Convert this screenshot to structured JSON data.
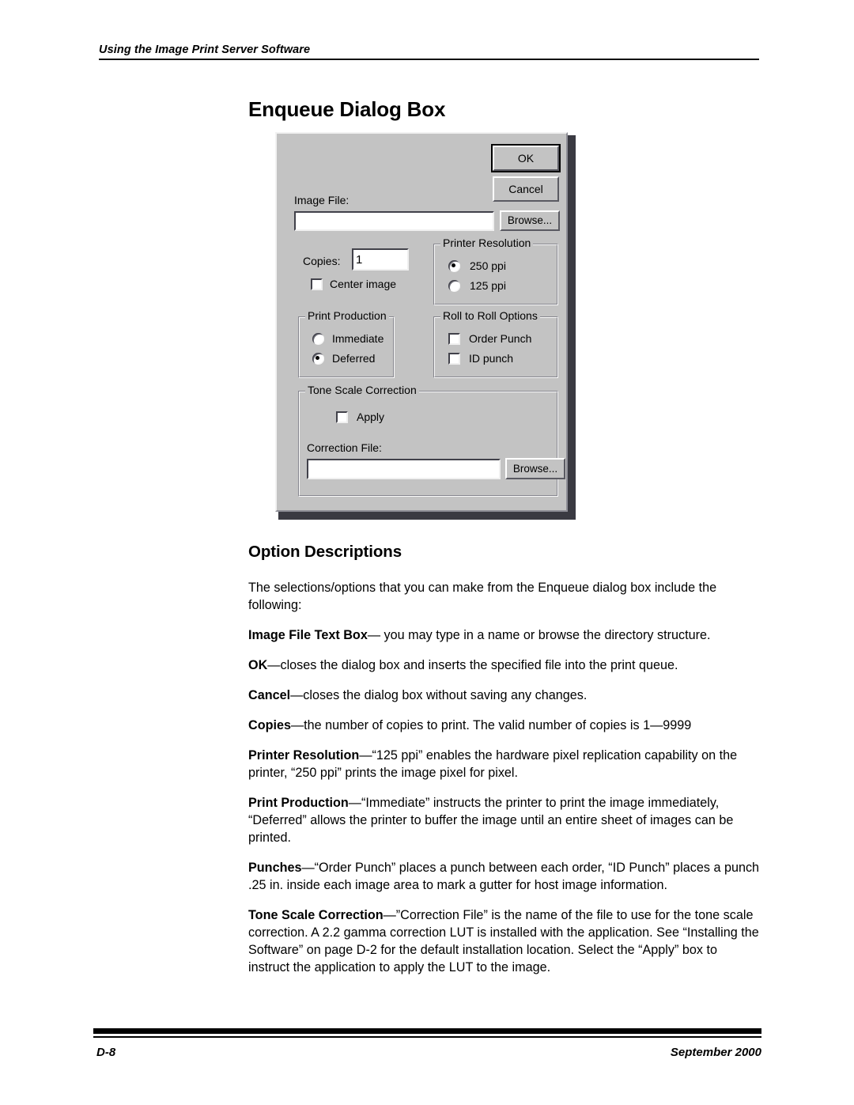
{
  "page": {
    "running_header": "Using the Image Print Server Software",
    "title": "Enqueue Dialog Box",
    "footer_left": "D-8",
    "footer_right": "September 2000"
  },
  "dialog": {
    "buttons": {
      "ok": "OK",
      "cancel": "Cancel",
      "browse_image": "Browse...",
      "browse_correction": "Browse..."
    },
    "image_file": {
      "label": "Image File:",
      "value": "",
      "placeholder": ""
    },
    "copies": {
      "label": "Copies:",
      "value": "1"
    },
    "center_image": {
      "label": "Center image",
      "checked": false
    },
    "printer_resolution": {
      "title": "Printer Resolution",
      "options": [
        {
          "label": "250 ppi",
          "selected": true
        },
        {
          "label": "125 ppi",
          "selected": false
        }
      ]
    },
    "print_production": {
      "title": "Print Production",
      "options": [
        {
          "label": "Immediate",
          "selected": false
        },
        {
          "label": "Deferred",
          "selected": true
        }
      ]
    },
    "roll_to_roll": {
      "title": "Roll to Roll Options",
      "options": [
        {
          "label": "Order Punch",
          "checked": false
        },
        {
          "label": "ID punch",
          "checked": false
        }
      ]
    },
    "tone_scale": {
      "title": "Tone Scale Correction",
      "apply_label": "Apply",
      "apply_checked": false,
      "correction_file_label": "Correction File:",
      "correction_file_value": "",
      "correction_file_placeholder": ""
    },
    "colors": {
      "face": "#c3c3c3",
      "highlight": "#ffffff",
      "shadow": "#5a5a62",
      "field": "#ffffff"
    }
  },
  "content": {
    "sub_heading": "Option Descriptions",
    "intro": "The selections/options that you can make from the Enqueue dialog box include the following:",
    "items": [
      {
        "term": "Image File Text Box",
        "sep": "— ",
        "text": "you may type in a name or browse the directory structure."
      },
      {
        "term": "OK",
        "sep": "—",
        "text": "closes the dialog box and inserts the specified file into the print queue."
      },
      {
        "term": "Cancel",
        "sep": "—",
        "text": "closes the dialog box without saving any changes."
      },
      {
        "term": "Copies",
        "sep": "—",
        "text": "the number of copies to print. The valid number of copies is 1—9999"
      },
      {
        "term": "Printer Resolution",
        "sep": "—",
        "text": "“125 ppi” enables the hardware pixel replication capability on the printer, “250 ppi” prints the image pixel for pixel."
      },
      {
        "term": "Print Production",
        "sep": "—",
        "text": "“Immediate” instructs the printer to print the image immediately, “Deferred” allows the printer to buffer the image until an entire sheet of images can be printed."
      },
      {
        "term": "Punches",
        "sep": "—",
        "text": "“Order Punch” places a punch between each order, “ID Punch” places a punch .25 in. inside each image area to mark a gutter for host image information."
      },
      {
        "term": "Tone Scale Correction",
        "sep": "—",
        "text": "”Correction File” is the name of the file to use for the tone scale correction. A 2.2 gamma correction LUT is installed with the application. See “Installing the Software” on page D-2 for the default installation location. Select the “Apply” box to instruct the application to apply the LUT to the image."
      }
    ]
  }
}
